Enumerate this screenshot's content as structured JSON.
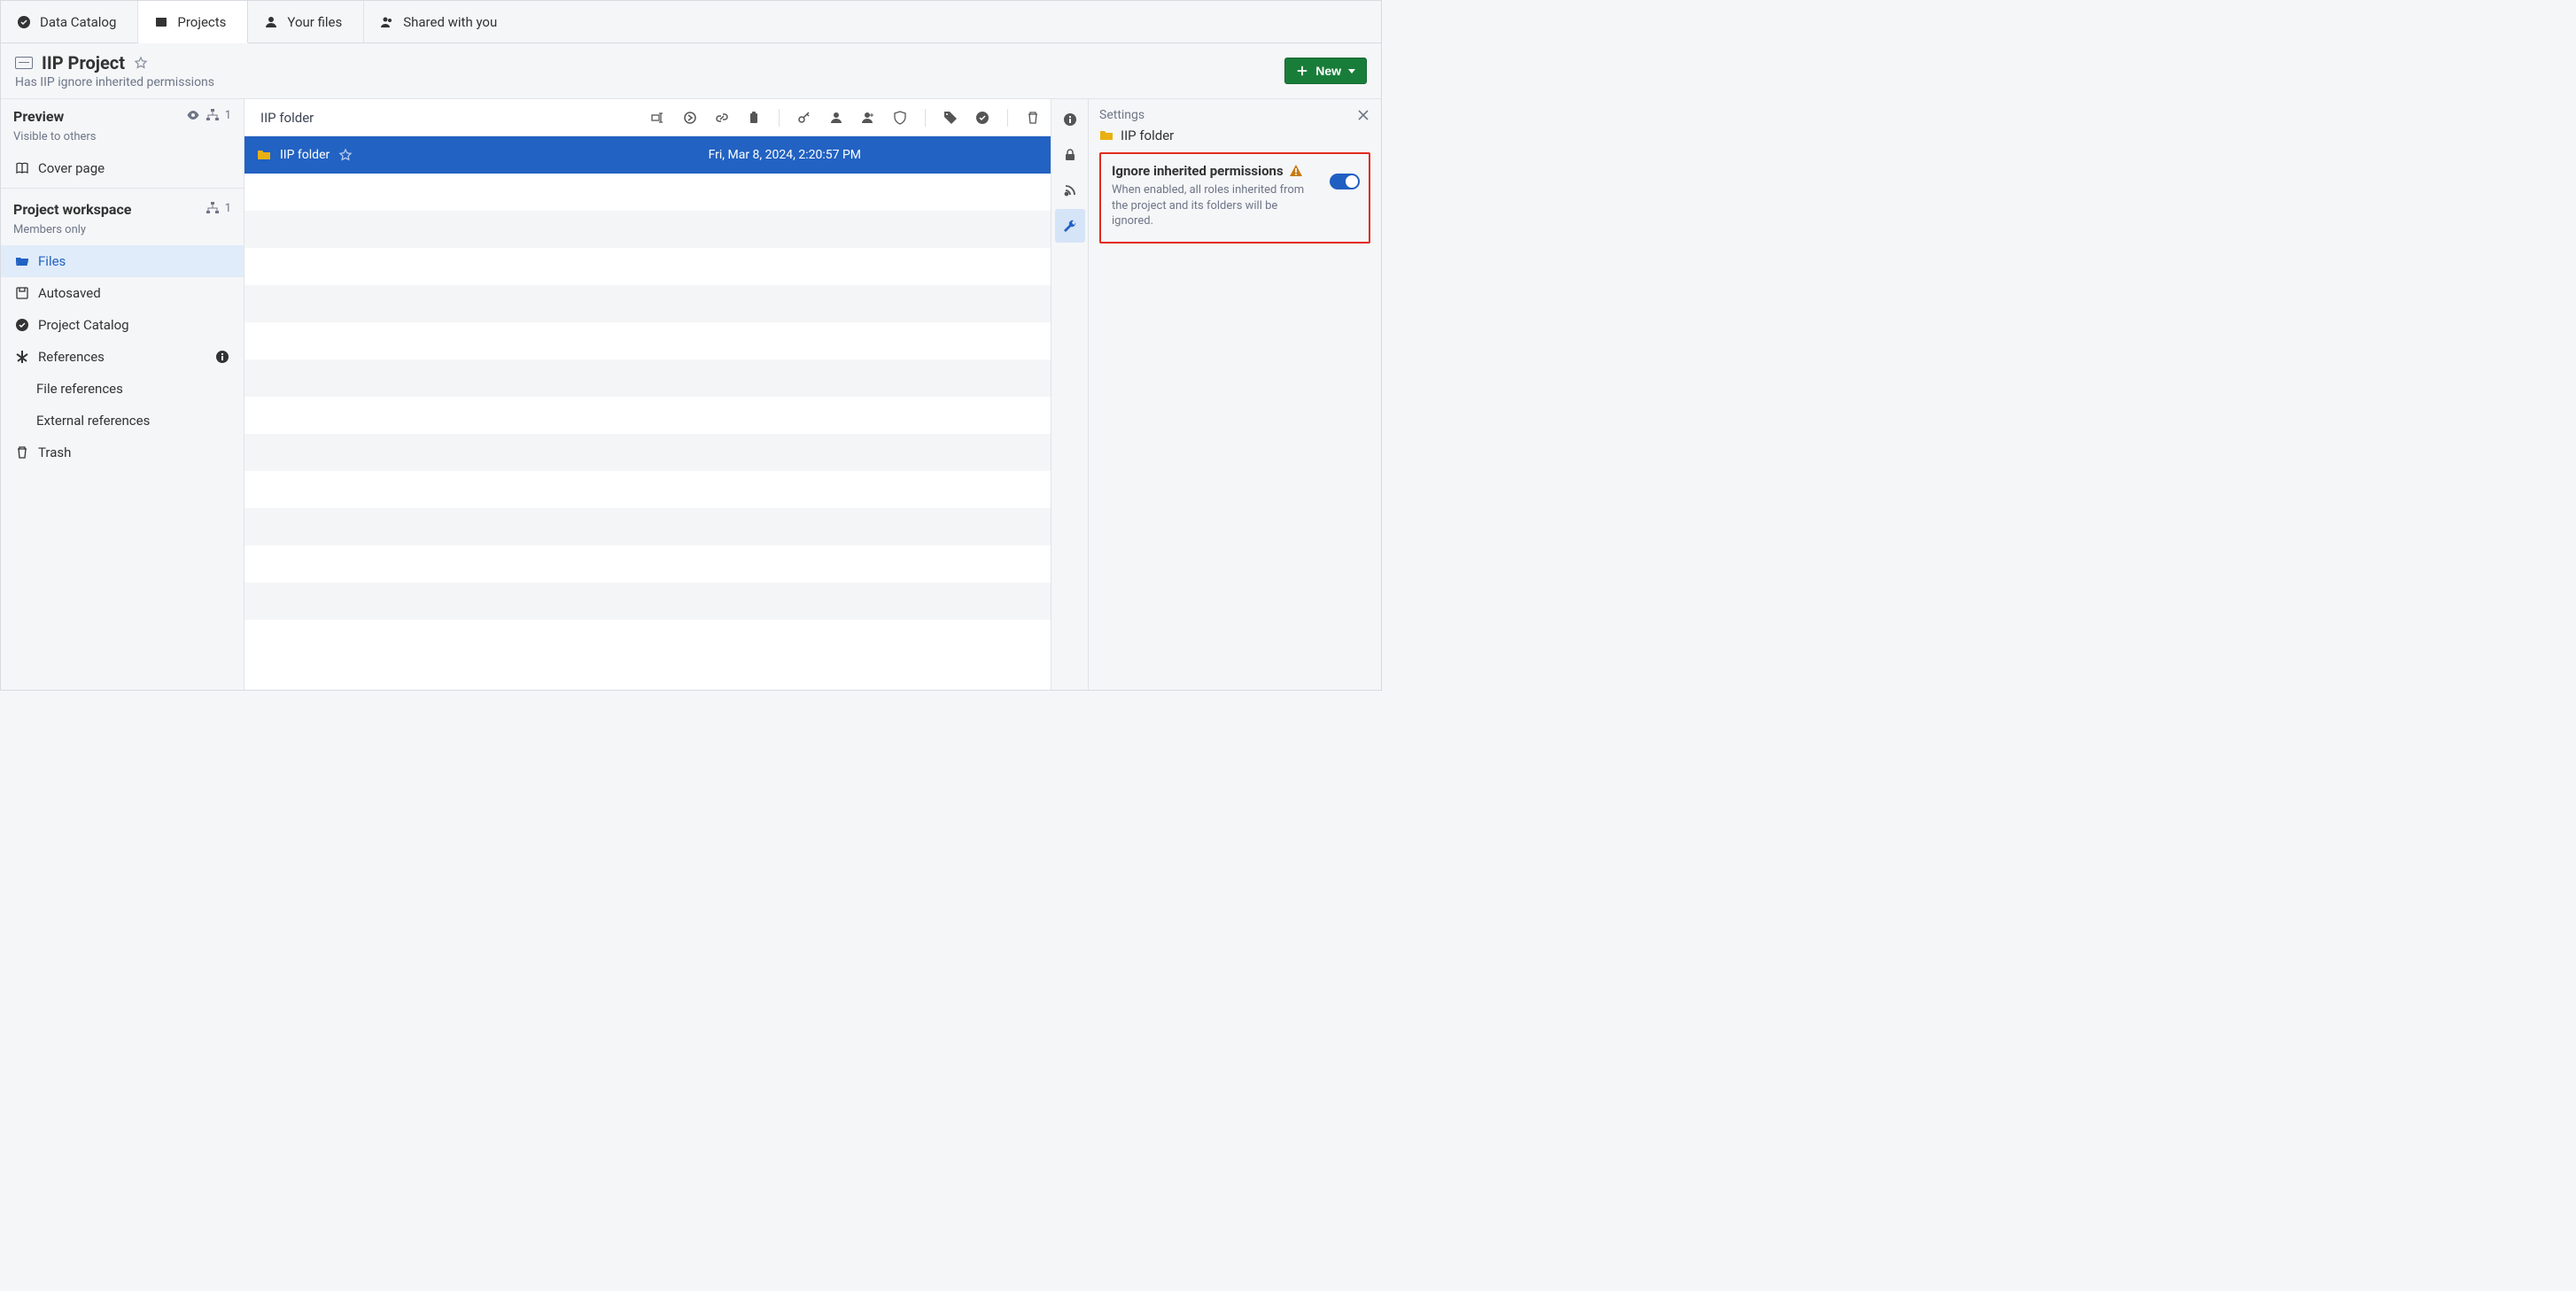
{
  "topnav": {
    "tabs": [
      {
        "label": "Data Catalog",
        "icon": "check-badge"
      },
      {
        "label": "Projects",
        "icon": "box"
      },
      {
        "label": "Your files",
        "icon": "user"
      },
      {
        "label": "Shared with you",
        "icon": "users"
      }
    ],
    "active_index": 1
  },
  "header": {
    "title": "IIP Project",
    "subtitle": "Has IIP ignore inherited permissions",
    "new_button_label": "New"
  },
  "sidebar": {
    "preview": {
      "label": "Preview",
      "sub": "Visible to others",
      "badge": "1"
    },
    "cover_page": "Cover page",
    "workspace": {
      "label": "Project workspace",
      "sub": "Members only",
      "badge": "1"
    },
    "items": {
      "files": "Files",
      "autosaved": "Autosaved",
      "project_catalog": "Project Catalog",
      "references": "References",
      "file_refs": "File references",
      "ext_refs": "External references",
      "trash": "Trash"
    }
  },
  "center": {
    "breadcrumb": "IIP folder",
    "selected_row": {
      "name": "IIP folder",
      "date": "Fri, Mar 8, 2024, 2:20:57 PM"
    }
  },
  "rail_active_index": 3,
  "rpanel": {
    "head": "Settings",
    "folder_name": "IIP folder",
    "box_title": "Ignore inherited permissions",
    "box_desc": "When enabled, all roles inherited from the project and its folders will be ignored."
  }
}
